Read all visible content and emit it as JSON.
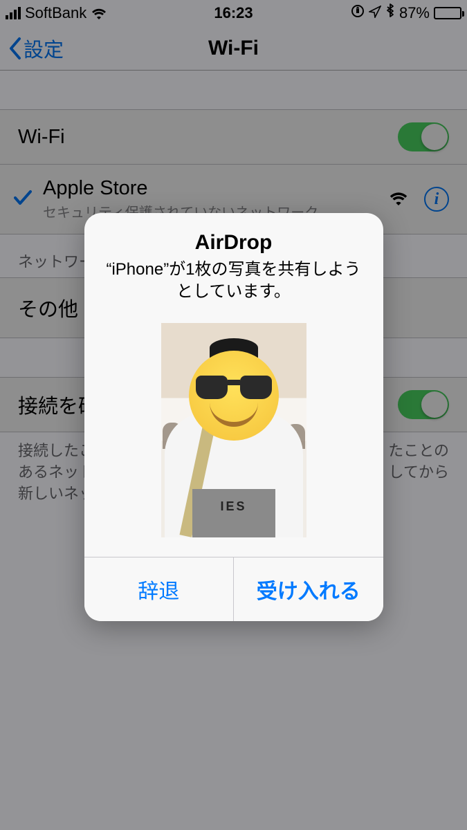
{
  "status": {
    "carrier": "SoftBank",
    "time": "16:23",
    "battery_pct": "87%"
  },
  "nav": {
    "back_label": "設定",
    "title": "Wi-Fi"
  },
  "wifi": {
    "row_label": "Wi-Fi",
    "ssid": "Apple Store",
    "ssid_sub": "セキュリティ保護されていないネットワーク"
  },
  "section": {
    "networks_header": "ネットワー",
    "other_label": "その他"
  },
  "ask": {
    "label": "接続を確",
    "footer_l1": "接続したこ",
    "footer_l2": "あるネット",
    "footer_l3": "新しいネッ",
    "footer_r1": "たことの",
    "footer_r2": "してから"
  },
  "alert": {
    "title": "AirDrop",
    "message": "“iPhone”が1枚の写真を共有しようとしています。",
    "shirt_text": "  IES",
    "decline": "辞退",
    "accept": "受け入れる"
  }
}
